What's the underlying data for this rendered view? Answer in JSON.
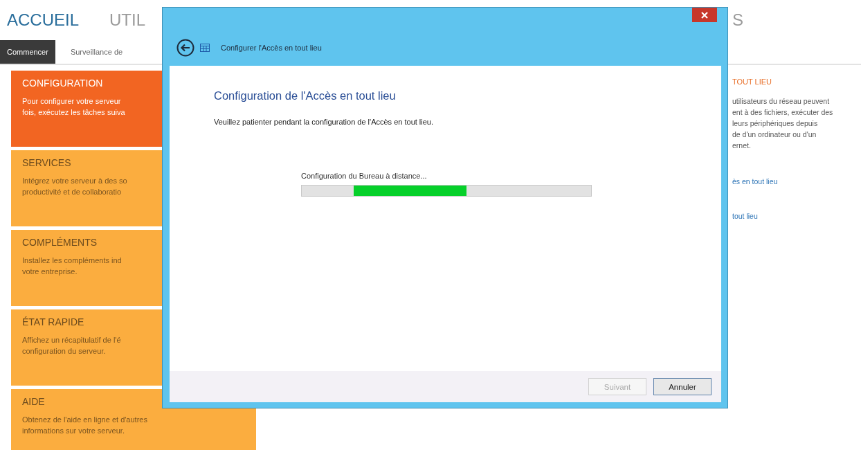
{
  "nav": [
    {
      "label": "ACCUEIL",
      "selected": true
    },
    {
      "label": "UTIL",
      "selected": false
    }
  ],
  "nav_right": "S",
  "tabs": [
    {
      "label": "Commencer",
      "selected": true
    },
    {
      "label": "Surveillance de",
      "selected": false
    }
  ],
  "tiles": [
    {
      "title": "CONFIGURATION",
      "text": [
        "Pour configurer votre serveur",
        "fois, exécutez les tâches suiva"
      ],
      "selected": true
    },
    {
      "title": "SERVICES",
      "text": [
        "Intégrez votre serveur à des so",
        "productivité et de collaboratio"
      ],
      "selected": false
    },
    {
      "title": "COMPLÉMENTS",
      "text": [
        "Installez les compléments ind",
        "votre entreprise."
      ],
      "selected": false
    },
    {
      "title": "ÉTAT RAPIDE",
      "text": [
        "Affichez un récapitulatif de l'é",
        "configuration du serveur."
      ],
      "selected": false
    },
    {
      "title": "AIDE",
      "text": [
        "Obtenez de l'aide en ligne et d'autres",
        "informations sur votre serveur."
      ],
      "selected": false
    }
  ],
  "right_panel": {
    "title": "TOUT LIEU",
    "text": [
      "utilisateurs du réseau peuvent",
      "ent à des fichiers, exécuter des",
      "leurs périphériques depuis",
      "de d'un ordinateur ou d'un",
      "ernet."
    ],
    "links": [
      "ès en tout lieu",
      "tout lieu"
    ]
  },
  "dialog": {
    "title": "Configurer l'Accès en tout lieu",
    "heading": "Configuration de l'Accès en tout lieu",
    "instruction": "Veuillez patienter pendant la configuration de l'Accès en tout lieu.",
    "progress": {
      "label": "Configuration du Bureau à distance...",
      "level": 0.39
    },
    "buttons": [
      {
        "label": "Suivant",
        "disabled": true
      },
      {
        "label": "Annuler",
        "disabled": false
      }
    ]
  }
}
